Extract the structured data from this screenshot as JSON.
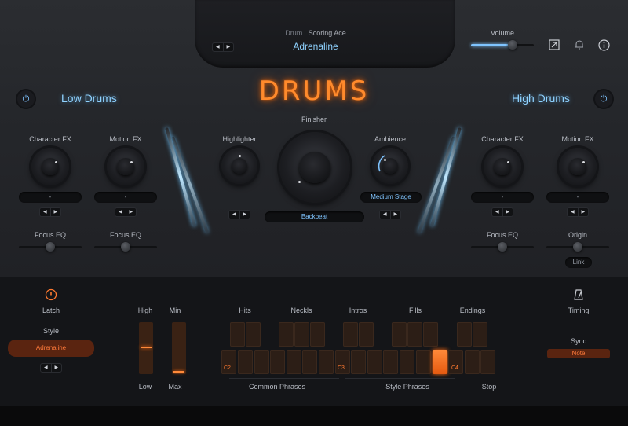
{
  "header": {
    "category": "Drum",
    "instrument": "Scoring Ace",
    "preset": "Adrenaline",
    "volume_label": "Volume",
    "title": "DRUMS"
  },
  "low": {
    "title": "Low Drums",
    "character_fx": "Character FX",
    "motion_fx": "Motion FX",
    "focus_eq_1": "Focus EQ",
    "focus_eq_2": "Focus EQ",
    "display_1": "-",
    "display_2": "-"
  },
  "center": {
    "finisher": "Finisher",
    "highlighter": "Highlighter",
    "ambience": "Ambience",
    "ambience_value": "Medium Stage",
    "finisher_value": "Backbeat"
  },
  "high": {
    "title": "High Drums",
    "character_fx": "Character FX",
    "motion_fx": "Motion FX",
    "focus_eq": "Focus EQ",
    "origin": "Origin",
    "link": "Link",
    "display_1": "-",
    "display_2": "-"
  },
  "bottom": {
    "latch": "Latch",
    "style": "Style",
    "style_value": "Adrenaline",
    "high": "High",
    "low": "Low",
    "min": "Min",
    "max": "Max",
    "hits": "Hits",
    "neckls": "Neckls",
    "intros": "Intros",
    "fills": "Fills",
    "endings": "Endings",
    "c2": "C2",
    "c3": "C3",
    "c4": "C4",
    "common_phrases": "Common Phrases",
    "style_phrases": "Style Phrases",
    "stop": "Stop",
    "timing": "Timing",
    "sync": "Sync",
    "sync_value": "Note"
  },
  "icons": [
    "prev-next-icon",
    "resize-icon",
    "bell-icon",
    "info-icon",
    "power-icon",
    "metronome-icon"
  ],
  "colors": {
    "accent_orange": "#ff8a2c",
    "accent_blue": "#8fd2ff"
  }
}
